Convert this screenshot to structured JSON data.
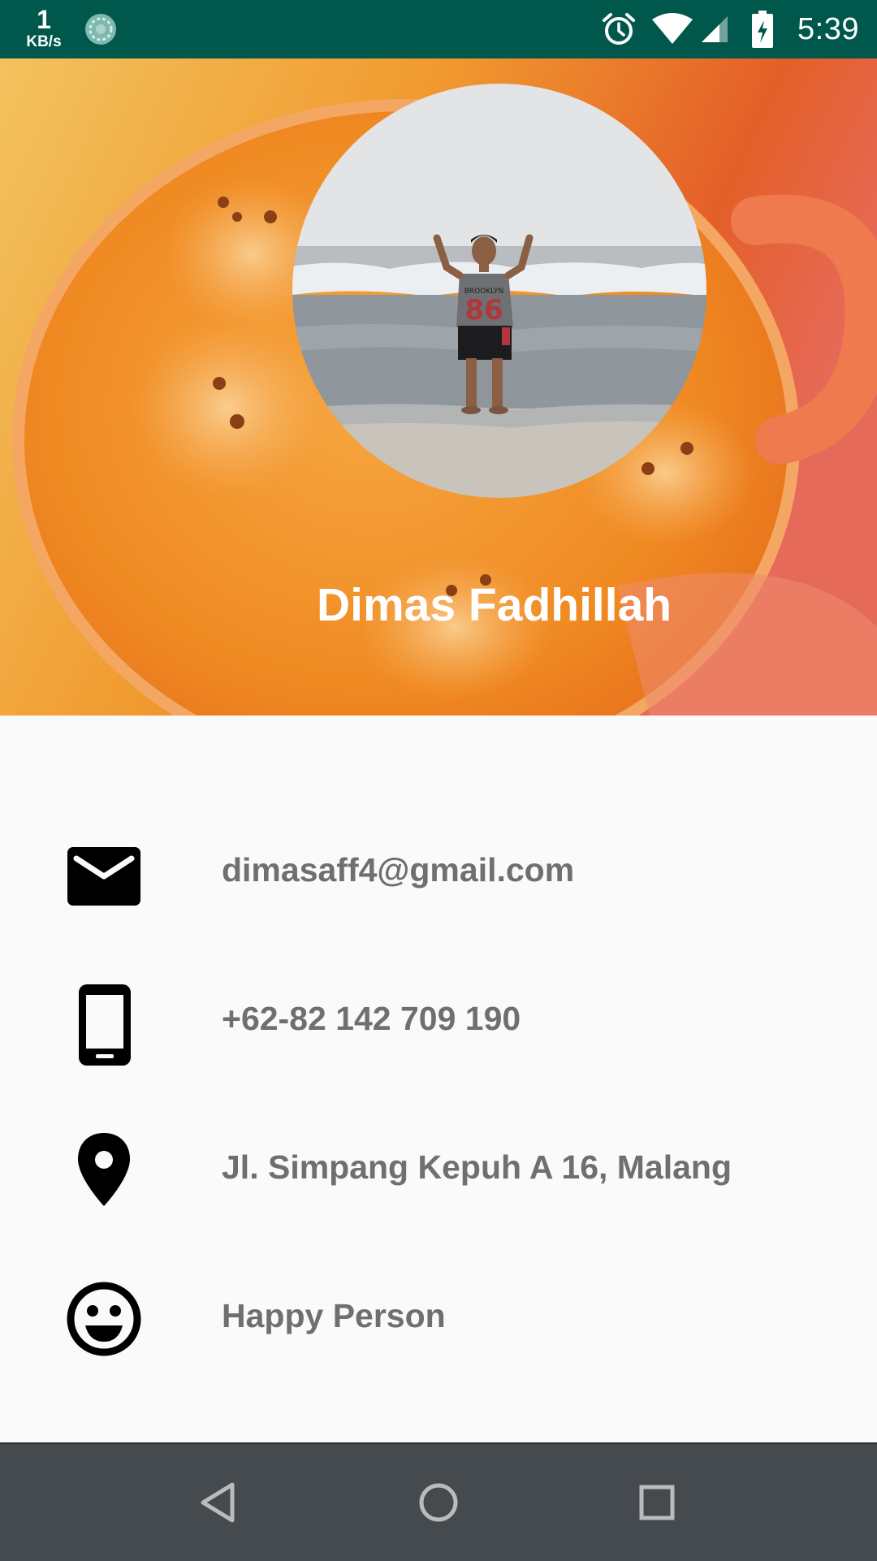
{
  "status_bar": {
    "net_speed_value": "1",
    "net_speed_unit": "KB/s",
    "time": "5:39",
    "icons": [
      "sync-icon",
      "alarm-icon",
      "wifi-icon",
      "cellular-signal-icon",
      "battery-charging-icon"
    ],
    "background_color": "#00574b"
  },
  "profile": {
    "name": "Dimas Fadhillah",
    "header_gradient": [
      "#f5b54a",
      "#ef7a1a",
      "#d9431d"
    ]
  },
  "info": [
    {
      "icon": "email-icon",
      "text": "dimasaff4@gmail.com"
    },
    {
      "icon": "phone-icon",
      "text": "+62-82 142 709 190"
    },
    {
      "icon": "location-pin-icon",
      "text": "Jl. Simpang Kepuh A 16, Malang"
    },
    {
      "icon": "smiley-icon",
      "text": "Happy Person"
    }
  ],
  "nav_bar": {
    "buttons": [
      "back-icon",
      "home-icon",
      "recents-icon"
    ],
    "background_color": "#454a4f"
  }
}
